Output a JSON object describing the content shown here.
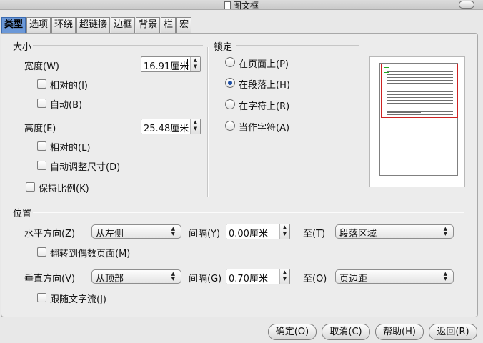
{
  "window": {
    "title": "图文框"
  },
  "tabs": [
    {
      "label": "类型",
      "active": true
    },
    {
      "label": "选项",
      "active": false
    },
    {
      "label": "环绕",
      "active": false
    },
    {
      "label": "超链接",
      "active": false
    },
    {
      "label": "边框",
      "active": false
    },
    {
      "label": "背景",
      "active": false
    },
    {
      "label": "栏",
      "active": false
    },
    {
      "label": "宏",
      "active": false
    }
  ],
  "size": {
    "title": "大小",
    "width_label": "宽度(W)",
    "width_value": "16.91厘米",
    "width_relative": {
      "label": "相对的(I)",
      "checked": false
    },
    "width_auto": {
      "label": "自动(B)",
      "checked": false
    },
    "height_label": "高度(E)",
    "height_value": "25.48厘米",
    "height_relative": {
      "label": "相对的(L)",
      "checked": false
    },
    "height_autofit": {
      "label": "自动调整尺寸(D)",
      "checked": false
    },
    "keep_ratio": {
      "label": "保持比例(K)",
      "checked": false
    }
  },
  "anchor": {
    "title": "锁定",
    "options": [
      {
        "label": "在页面上(P)",
        "checked": false
      },
      {
        "label": "在段落上(H)",
        "checked": true
      },
      {
        "label": "在字符上(R)",
        "checked": false
      },
      {
        "label": "当作字符(A)",
        "checked": false
      }
    ]
  },
  "position": {
    "title": "位置",
    "horizontal_label": "水平方向(Z)",
    "horizontal_value": "从左侧",
    "h_by_label": "间隔(Y)",
    "h_by_value": "0.00厘米",
    "h_to_label": "至(T)",
    "h_to_value": "段落区域",
    "mirror": {
      "label": "翻转到偶数页面(M)",
      "checked": false
    },
    "vertical_label": "垂直方向(V)",
    "vertical_value": "从顶部",
    "v_by_label": "间隔(G)",
    "v_by_value": "0.70厘米",
    "v_to_label": "至(O)",
    "v_to_value": "页边距",
    "follow_flow": {
      "label": "跟随文字流(J)",
      "checked": false
    }
  },
  "buttons": {
    "ok": "确定(O)",
    "cancel": "取消(C)",
    "help": "帮助(H)",
    "reset": "返回(R)"
  },
  "icons": {
    "spin_arrows": "▲▼",
    "dropdown_arrows": "▲▼"
  }
}
